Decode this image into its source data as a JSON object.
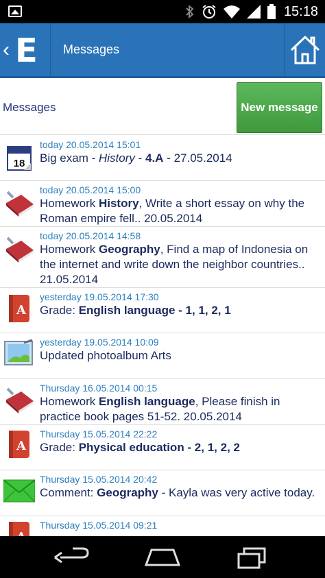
{
  "status_bar": {
    "time": "15:18",
    "icons": [
      "gallery-icon",
      "bluetooth-icon",
      "alarm-icon",
      "wifi-icon",
      "signal-icon",
      "battery-icon"
    ]
  },
  "app_bar": {
    "logo": "E",
    "title": "Messages",
    "back_icon": "chevron-left-icon",
    "home_icon": "home-icon"
  },
  "sub_header": {
    "title": "Messages",
    "new_button": "New message"
  },
  "messages": [
    {
      "icon": "calendar-icon",
      "date": "today 20.05.2014 15:01",
      "p1": "Big exam  - ",
      "em": "History",
      "p2": " - ",
      "b": "4.A",
      "p3": " - 27.05.2014"
    },
    {
      "icon": "homework-book-icon",
      "date": "today 20.05.2014 15:00",
      "p1": "Homework ",
      "b": "History",
      "p2": ", Write a short essay on why the Roman empire fell.. 20.05.2014"
    },
    {
      "icon": "homework-book-icon",
      "date": "today 20.05.2014 14:58",
      "p1": "Homework ",
      "b": "Geography",
      "p2": ", Find a map of Indonesia on the internet and write down the neighbor countries.. 21.05.2014"
    },
    {
      "icon": "grade-book-icon",
      "date": "yesterday 19.05.2014 17:30",
      "p1": "Grade: ",
      "b": "English language - 1, 1, 2, 1"
    },
    {
      "icon": "photo-album-icon",
      "date": "yesterday 19.05.2014 10:09",
      "p1": "Updated photoalbum Arts"
    },
    {
      "icon": "homework-book-icon",
      "date": "Thursday 16.05.2014 00:15",
      "p1": "Homework ",
      "b": "English language",
      "p2": ", Please finish in practice book pages 51-52. 20.05.2014"
    },
    {
      "icon": "grade-book-icon",
      "date": "Thursday 15.05.2014 22:22",
      "p1": "Grade: ",
      "b": "Physical education - 2, 1, 2, 2"
    },
    {
      "icon": "envelope-icon",
      "date": "Thursday 15.05.2014 20:42",
      "p1": "Comment: ",
      "b": "Geography",
      "p2": " - Kayla was very active today."
    },
    {
      "icon": "grade-book-icon",
      "date": "Thursday 15.05.2014 09:21",
      "p1": ""
    }
  ],
  "colors": {
    "app_bar": "#2a73b8",
    "date_text": "#2c7fbd",
    "body_text": "#1b2a5e",
    "new_button": "#4cac49"
  },
  "nav_bar": {
    "icons": [
      "back-icon",
      "home-icon",
      "recent-apps-icon"
    ]
  }
}
